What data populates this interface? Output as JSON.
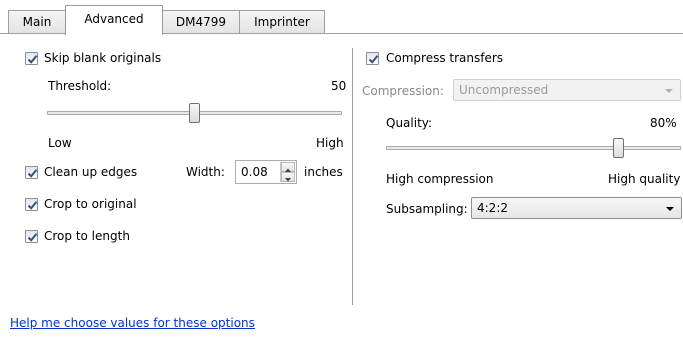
{
  "tabs": [
    "Main",
    "Advanced",
    "DM4799",
    "Imprinter"
  ],
  "left": {
    "skip_blank": {
      "label": "Skip blank originals",
      "checked": true
    },
    "threshold": {
      "label": "Threshold:",
      "value": "50",
      "min_label": "Low",
      "max_label": "High",
      "level": 0.5
    },
    "clean_edges": {
      "label": "Clean up edges",
      "checked": true,
      "width_label": "Width:",
      "width_value": "0.08",
      "unit": "inches"
    },
    "crop_original": {
      "label": "Crop to original",
      "checked": true
    },
    "crop_length": {
      "label": "Crop to length",
      "checked": true
    }
  },
  "right": {
    "compress": {
      "label": "Compress transfers",
      "checked": true
    },
    "compression": {
      "label": "Compression:",
      "value": "Uncompressed"
    },
    "quality": {
      "label": "Quality:",
      "value": "80%",
      "min_label": "High compression",
      "max_label": "High quality",
      "level": 0.8
    },
    "subsampling": {
      "label": "Subsampling:",
      "value": "4:2:2"
    }
  },
  "help_link": "Help me choose values for these options"
}
